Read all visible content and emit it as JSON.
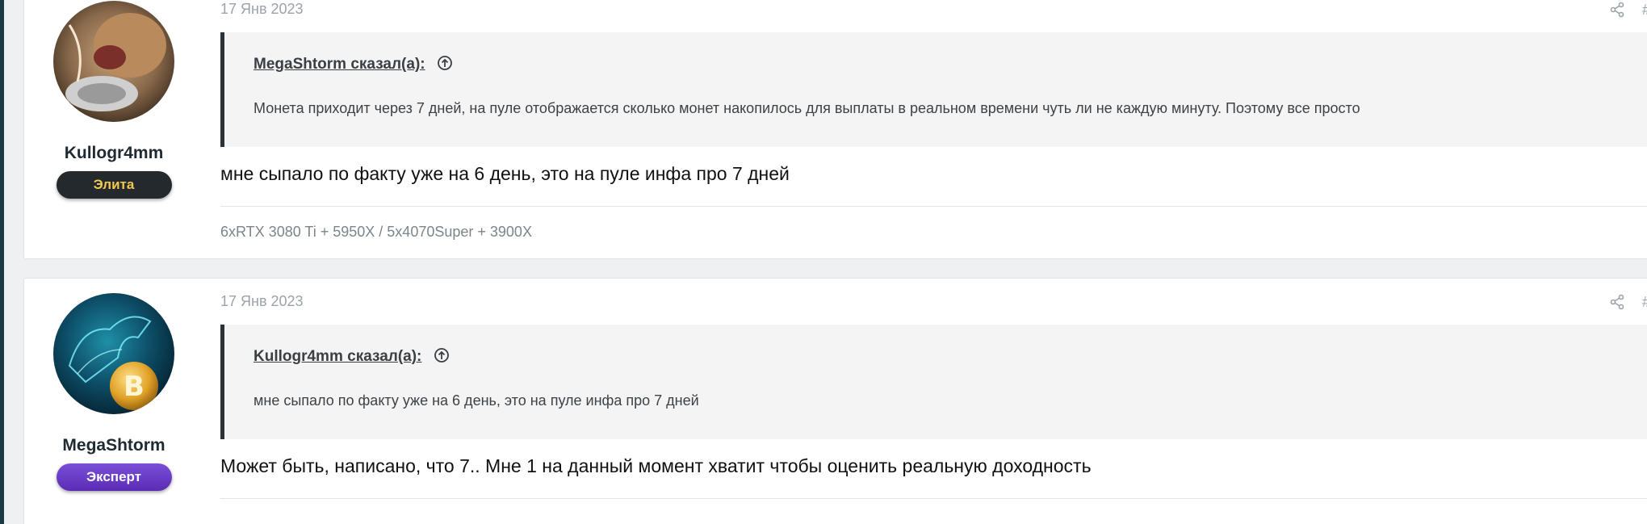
{
  "posts": [
    {
      "user": {
        "name": "Kullogr4mm",
        "badge": "Элита",
        "avatar_icon": "cat-avatar-icon"
      },
      "date": "17 Янв 2023",
      "hash": "#",
      "quote": {
        "author_line": "MegaShtorm сказал(а):",
        "text": "Монета приходит через 7 дней, на пуле отображается сколько монет накопилось для выплаты в реальном времени чуть ли не каждую минуту. Поэтому все просто"
      },
      "message": "мне сыпало по факту уже на 6 день, это на пуле инфа про 7 дней",
      "signature": "6xRTX 3080 Ti + 5950X / 5x4070Super + 3900X"
    },
    {
      "user": {
        "name": "MegaShtorm",
        "badge": "Эксперт",
        "avatar_icon": "bitcoin-bull-avatar-icon"
      },
      "date": "17 Янв 2023",
      "hash": "#",
      "quote": {
        "author_line": "Kullogr4mm сказал(а):",
        "text": "мне сыпало по факту уже на 6 день, это на пуле инфа про 7 дней"
      },
      "message": "Может быть, написано, что 7.. Мне 1 на данный момент хватит чтобы оценить реальную доходность"
    }
  ],
  "colors": {
    "elite_badge_bg": "#24292e",
    "elite_badge_text": "#f2c94c",
    "expert_badge_bg": "#6a3cc8",
    "quote_border": "#2b3238"
  }
}
